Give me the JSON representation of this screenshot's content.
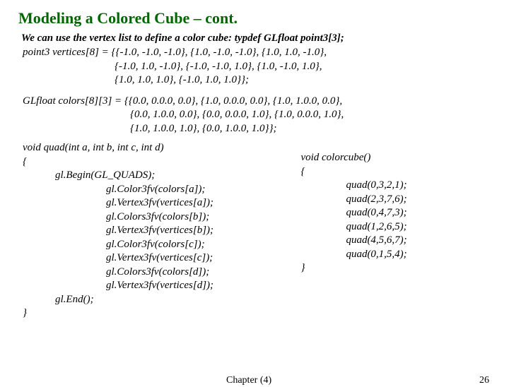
{
  "title": "Modeling a Colored Cube – cont.",
  "intro": "We can use the vertex list to define a color cube: typdef GLfloat point3[3];",
  "vertices": {
    "l1": "point3 vertices[8] = {{-1.0, -1.0, -1.0}, {1.0, -1.0, -1.0}, {1.0, 1.0, -1.0},",
    "l2": "{-1.0, 1.0, -1.0},  {-1.0, -1.0, 1.0}, {1.0, -1.0, 1.0},",
    "l3": "{1.0, 1.0, 1.0}, {-1.0, 1.0, 1.0}};"
  },
  "colors": {
    "l1": "GLfloat colors[8][3] = {{0.0, 0.0.0, 0.0}, {1.0, 0.0.0, 0.0}, {1.0, 1.0.0, 0.0},",
    "l2": "{0.0, 1.0.0, 0.0},  {0.0, 0.0.0, 1.0}, {1.0, 0.0.0, 1.0},",
    "l3": "{1.0, 1.0.0, 1.0}, {0.0, 1.0.0, 1.0}};"
  },
  "quad": {
    "sig": "void quad(int a, int b, int c, int d)",
    "open": "{",
    "begin": "gl.Begin(GL_QUADS);",
    "b1": "gl.Color3fv(colors[a]);",
    "b2": "gl.Vertex3fv(vertices[a]);",
    "b3": "gl.Colors3fv(colors[b]);",
    "b4": "gl.Vertex3fv(vertices[b]);",
    "b5": "gl.Color3fv(colors[c]);",
    "b6": "gl.Vertex3fv(vertices[c]);",
    "b7": "gl.Colors3fv(colors[d]);",
    "b8": "gl.Vertex3fv(vertices[d]);",
    "end": "gl.End();",
    "close": "}"
  },
  "cube": {
    "sig": "void colorcube()",
    "open": "{",
    "c1": "quad(0,3,2,1);",
    "c2": "quad(2,3,7,6);",
    "c3": "quad(0,4,7,3);",
    "c4": "quad(1,2,6,5);",
    "c5": "quad(4,5,6,7);",
    "c6": "quad(0,1,5,4);",
    "close": "}"
  },
  "footer": {
    "chapter": "Chapter (4)",
    "page": "26"
  }
}
